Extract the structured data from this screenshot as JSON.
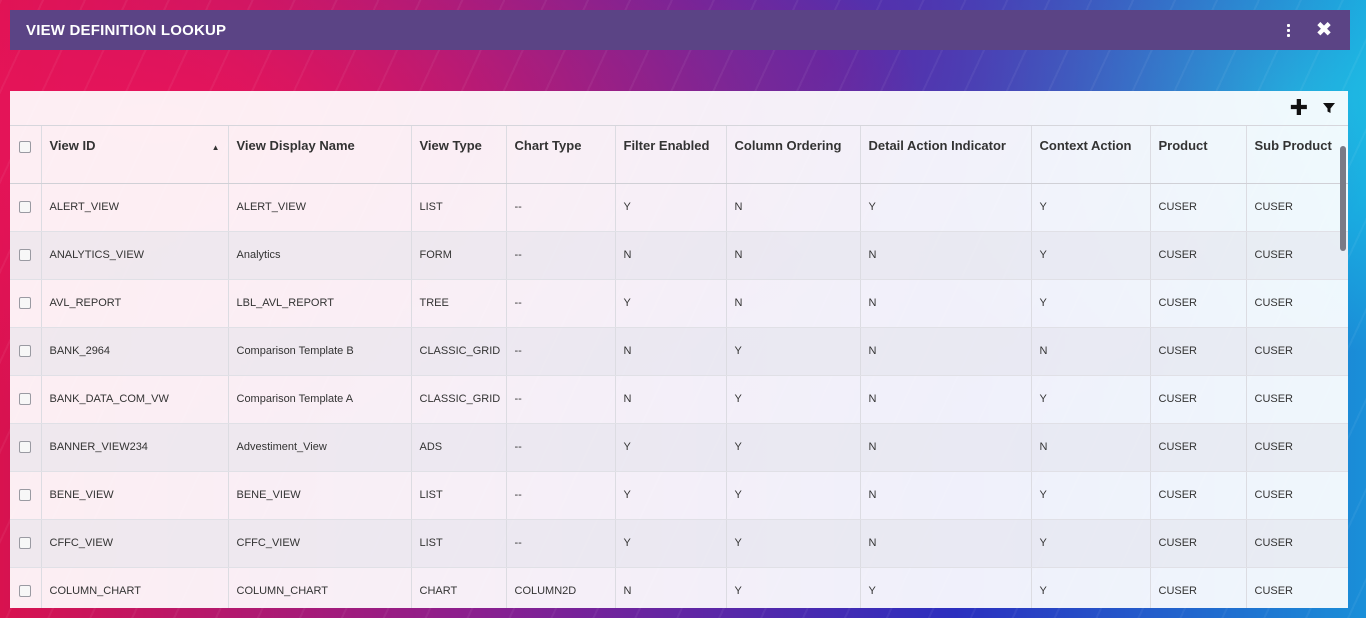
{
  "window": {
    "title": "VIEW DEFINITION LOOKUP"
  },
  "table": {
    "columns": [
      {
        "label": "View ID"
      },
      {
        "label": "View Display Name"
      },
      {
        "label": "View Type"
      },
      {
        "label": "Chart Type"
      },
      {
        "label": "Filter Enabled"
      },
      {
        "label": "Column Ordering"
      },
      {
        "label": "Detail Action Indicator"
      },
      {
        "label": "Context Action"
      },
      {
        "label": "Product"
      },
      {
        "label": "Sub Product"
      }
    ],
    "rows": [
      [
        "ALERT_VIEW",
        "ALERT_VIEW",
        "LIST",
        "--",
        "Y",
        "N",
        "Y",
        "Y",
        "CUSER",
        "CUSER"
      ],
      [
        "ANALYTICS_VIEW",
        "Analytics",
        "FORM",
        "--",
        "N",
        "N",
        "N",
        "Y",
        "CUSER",
        "CUSER"
      ],
      [
        "AVL_REPORT",
        "LBL_AVL_REPORT",
        "TREE",
        "--",
        "Y",
        "N",
        "N",
        "Y",
        "CUSER",
        "CUSER"
      ],
      [
        "BANK_2964",
        "Comparison Template B",
        "CLASSIC_GRID",
        "--",
        "N",
        "Y",
        "N",
        "N",
        "CUSER",
        "CUSER"
      ],
      [
        "BANK_DATA_COM_VW",
        "Comparison Template A",
        "CLASSIC_GRID",
        "--",
        "N",
        "Y",
        "N",
        "Y",
        "CUSER",
        "CUSER"
      ],
      [
        "BANNER_VIEW234",
        "Advestiment_View",
        "ADS",
        "--",
        "Y",
        "Y",
        "N",
        "N",
        "CUSER",
        "CUSER"
      ],
      [
        "BENE_VIEW",
        "BENE_VIEW",
        "LIST",
        "--",
        "Y",
        "Y",
        "N",
        "Y",
        "CUSER",
        "CUSER"
      ],
      [
        "CFFC_VIEW",
        "CFFC_VIEW",
        "LIST",
        "--",
        "Y",
        "Y",
        "N",
        "Y",
        "CUSER",
        "CUSER"
      ],
      [
        "COLUMN_CHART",
        "COLUMN_CHART",
        "CHART",
        "COLUMN2D",
        "N",
        "Y",
        "Y",
        "Y",
        "CUSER",
        "CUSER"
      ]
    ]
  },
  "icons": {
    "more": "more-vertical-icon",
    "close": "close-icon",
    "add": "plus-icon",
    "filter": "filter-icon",
    "sort": "sort-ascending-icon"
  },
  "colors": {
    "titlebar": "#5b4485",
    "panel": "#ffffff"
  }
}
